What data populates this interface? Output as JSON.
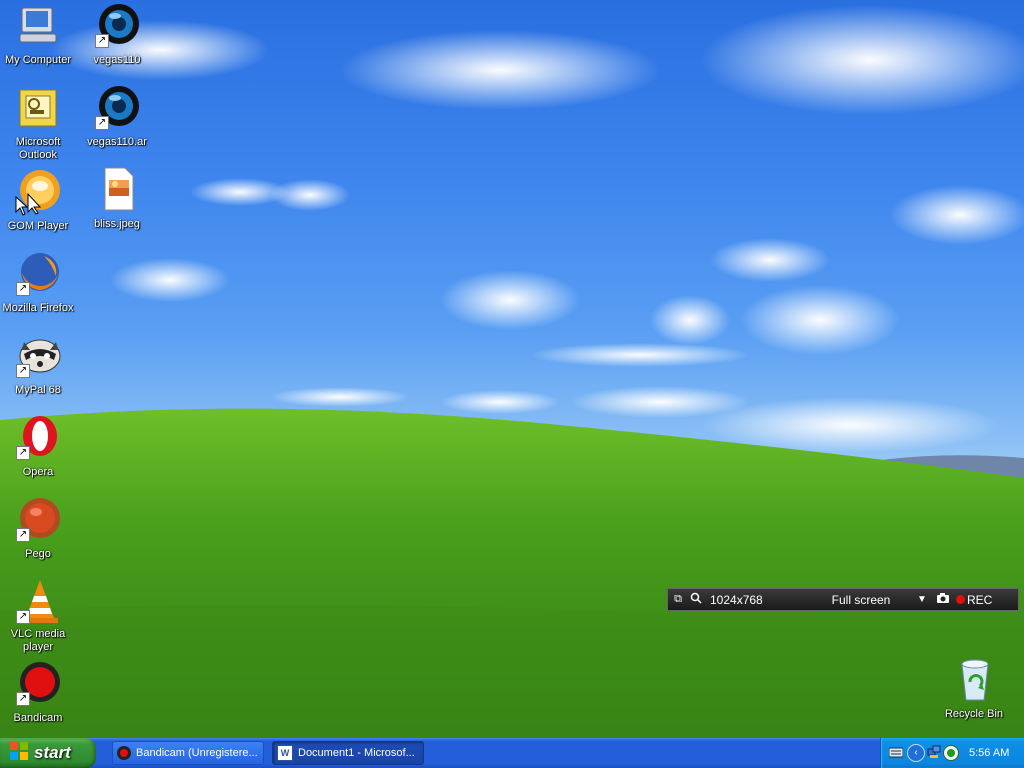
{
  "desktop": {
    "icons_left": [
      {
        "label": "My Computer",
        "icon": "my-computer-icon"
      },
      {
        "label": "Microsoft Outlook",
        "icon": "outlook-icon"
      },
      {
        "label": "GOM Player",
        "icon": "gom-player-icon"
      },
      {
        "label": "Mozilla Firefox",
        "icon": "firefox-icon"
      },
      {
        "label": "MyPal 68",
        "icon": "mypal-icon"
      },
      {
        "label": "Opera",
        "icon": "opera-icon"
      },
      {
        "label": "Pego",
        "icon": "pego-icon"
      },
      {
        "label": "VLC media player",
        "icon": "vlc-icon"
      },
      {
        "label": "Bandicam",
        "icon": "bandicam-icon"
      }
    ],
    "icons_second": [
      {
        "label": "vegas110",
        "icon": "vegas-icon"
      },
      {
        "label": "vegas110.ar",
        "icon": "vegas-icon"
      },
      {
        "label": "bliss.jpeg",
        "icon": "jpeg-file-icon"
      }
    ],
    "recycle_bin": {
      "label": "Recycle Bin",
      "icon": "recycle-bin-icon"
    }
  },
  "bandicam_bar": {
    "resolution": "1024x768",
    "mode": "Full screen",
    "rec_label": "REC"
  },
  "taskbar": {
    "start_label": "start",
    "tasks": [
      {
        "label": "Bandicam (Unregistere...",
        "icon": "bandicam-icon"
      },
      {
        "label": "Document1 - Microsof...",
        "icon": "word-icon"
      }
    ],
    "clock": "5:56 AM"
  },
  "colors": {
    "taskbar_blue": "#245edb",
    "start_green": "#2e8b2e",
    "tray_blue": "#0c86de",
    "rec_red": "#e01010"
  }
}
